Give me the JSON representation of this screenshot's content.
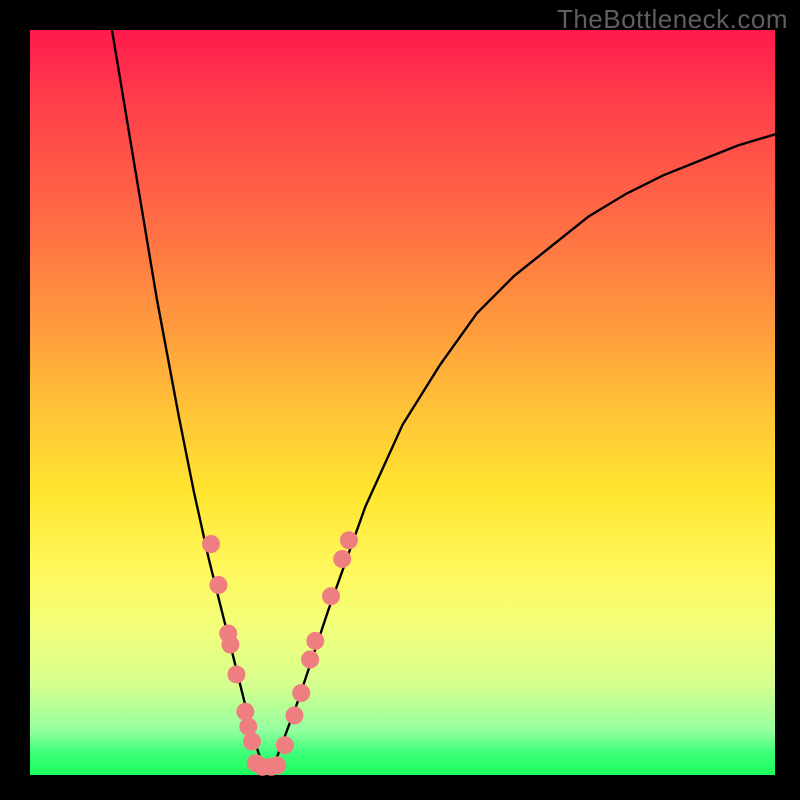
{
  "watermark": "TheBottleneck.com",
  "chart_data": {
    "type": "line",
    "title": "",
    "xlabel": "",
    "ylabel": "",
    "xlim": [
      0,
      100
    ],
    "ylim": [
      0,
      100
    ],
    "grid": false,
    "legend": false,
    "series": [
      {
        "name": "bottleneck-curve",
        "color": "#000000",
        "x": [
          11,
          14,
          17,
          20,
          22,
          24,
          26,
          27.5,
          29,
          30,
          31,
          32,
          33,
          36,
          40,
          45,
          50,
          55,
          60,
          65,
          70,
          75,
          80,
          85,
          90,
          95,
          100
        ],
        "y": [
          100,
          82,
          64,
          48,
          38,
          29,
          21,
          15,
          9,
          5,
          2,
          1,
          2,
          10,
          22,
          36,
          47,
          55,
          62,
          67,
          71,
          75,
          78,
          80.5,
          82.5,
          84.5,
          86
        ]
      }
    ],
    "markers": {
      "color": "#ef7e81",
      "radius_px": 9,
      "points": [
        {
          "x": 24.3,
          "y": 31
        },
        {
          "x": 25.3,
          "y": 25.5
        },
        {
          "x": 26.6,
          "y": 19
        },
        {
          "x": 26.9,
          "y": 17.5
        },
        {
          "x": 27.7,
          "y": 13.5
        },
        {
          "x": 28.9,
          "y": 8.5
        },
        {
          "x": 29.3,
          "y": 6.5
        },
        {
          "x": 29.8,
          "y": 4.5
        },
        {
          "x": 30.3,
          "y": 1.6
        },
        {
          "x": 31.2,
          "y": 1.1
        },
        {
          "x": 32.4,
          "y": 1.1
        },
        {
          "x": 33.2,
          "y": 1.3
        },
        {
          "x": 34.2,
          "y": 4
        },
        {
          "x": 35.5,
          "y": 8
        },
        {
          "x": 36.4,
          "y": 11
        },
        {
          "x": 37.6,
          "y": 15.5
        },
        {
          "x": 38.3,
          "y": 18
        },
        {
          "x": 40.4,
          "y": 24
        },
        {
          "x": 41.9,
          "y": 29
        },
        {
          "x": 42.8,
          "y": 31.5
        }
      ]
    },
    "background_gradient": {
      "type": "vertical",
      "stops": [
        {
          "pos": 0.0,
          "color": "#ff1a4d"
        },
        {
          "pos": 0.5,
          "color": "#ffc637"
        },
        {
          "pos": 0.8,
          "color": "#f3ff7a"
        },
        {
          "pos": 1.0,
          "color": "#1aff5c"
        }
      ]
    }
  }
}
